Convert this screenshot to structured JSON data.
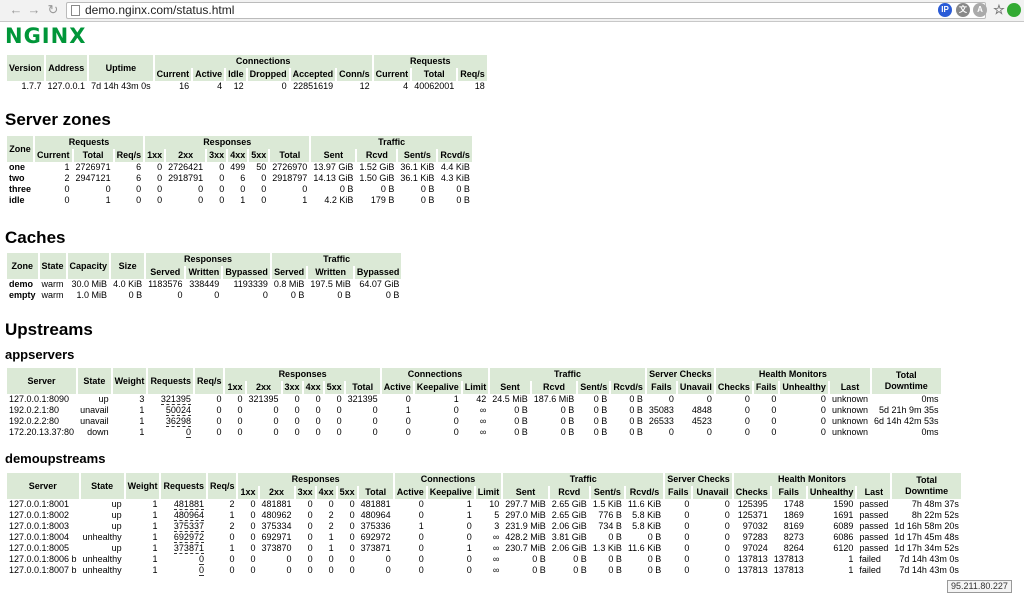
{
  "browser": {
    "url": "demo.nginx.com/status.html",
    "back_icon": "←",
    "forward_icon": "→"
  },
  "logo": {
    "text": "NGINX"
  },
  "colors": {
    "header_bg": "#dbe9d6",
    "logo": "#009639"
  },
  "summary": {
    "group_headers": {
      "connections": "Connections",
      "requests": "Requests"
    },
    "headers": [
      "Version",
      "Address",
      "Uptime",
      "Current",
      "Active",
      "Idle",
      "Dropped",
      "Accepted",
      "Conn/s",
      "Current",
      "Total",
      "Req/s"
    ],
    "row": [
      "1.7.7",
      "127.0.0.1",
      "7d 14h 43m 0s",
      "16",
      "4",
      "12",
      "0",
      "22851619",
      "12",
      "4",
      "40062001",
      "18"
    ]
  },
  "server_zones": {
    "title": "Server zones",
    "group_headers": {
      "zone": "Zone",
      "requests": "Requests",
      "responses": "Responses",
      "traffic": "Traffic"
    },
    "headers": [
      "Current",
      "Total",
      "Req/s",
      "1xx",
      "2xx",
      "3xx",
      "4xx",
      "5xx",
      "Total",
      "Sent",
      "Rcvd",
      "Sent/s",
      "Rcvd/s"
    ],
    "rows": [
      [
        "one",
        "1",
        "2726971",
        "6",
        "0",
        "2726421",
        "0",
        "499",
        "50",
        "2726970",
        "13.97 GiB",
        "1.52 GiB",
        "36.1 KiB",
        "4.4 KiB"
      ],
      [
        "two",
        "2",
        "2947121",
        "6",
        "0",
        "2918791",
        "0",
        "6",
        "0",
        "2918797",
        "14.13 GiB",
        "1.50 GiB",
        "36.1 KiB",
        "4.3 KiB"
      ],
      [
        "three",
        "0",
        "0",
        "0",
        "0",
        "0",
        "0",
        "0",
        "0",
        "0",
        "0 B",
        "0 B",
        "0 B",
        "0 B"
      ],
      [
        "idle",
        "0",
        "1",
        "0",
        "0",
        "0",
        "0",
        "1",
        "0",
        "1",
        "4.2 KiB",
        "179 B",
        "0 B",
        "0 B"
      ]
    ]
  },
  "caches": {
    "title": "Caches",
    "group_headers": {
      "responses": "Responses",
      "traffic": "Traffic"
    },
    "headers": [
      "Zone",
      "State",
      "Capacity",
      "Size",
      "Served",
      "Written",
      "Bypassed",
      "Served",
      "Written",
      "Bypassed"
    ],
    "rows": [
      [
        "demo",
        "warm",
        "30.0 MiB",
        "4.0 KiB",
        "1183576",
        "338449",
        "1193339",
        "0.8 MiB",
        "197.5 MiB",
        "64.07 GiB"
      ],
      [
        "empty",
        "warm",
        "1.0 MiB",
        "0 B",
        "0",
        "0",
        "0",
        "0 B",
        "0 B",
        "0 B"
      ]
    ]
  },
  "upstreams": {
    "title": "Upstreams",
    "group_headers": {
      "responses": "Responses",
      "connections": "Connections",
      "traffic": "Traffic",
      "server_checks": "Server Checks",
      "health_monitors": "Health Monitors",
      "total_downtime": "Total Downtime"
    },
    "headers": [
      "Server",
      "State",
      "Weight",
      "Requests",
      "Req/s",
      "1xx",
      "2xx",
      "3xx",
      "4xx",
      "5xx",
      "Total",
      "Active",
      "Keepalive",
      "Limit",
      "Sent",
      "Rcvd",
      "Sent/s",
      "Rcvd/s",
      "Fails",
      "Unavail",
      "Checks",
      "Fails",
      "Unhealthy",
      "Last"
    ],
    "appservers": {
      "title": "appservers",
      "rows": [
        [
          "127.0.0.1:8090",
          "up",
          "3",
          "321395",
          "0",
          "0",
          "321395",
          "0",
          "0",
          "0",
          "321395",
          "0",
          "1",
          "42",
          "24.5 MiB",
          "187.6 MiB",
          "0 B",
          "0 B",
          "0",
          "0",
          "0",
          "0",
          "0",
          "unknown",
          "0ms"
        ],
        [
          "192.0.2.1:80",
          "unavail",
          "1",
          "50024",
          "0",
          "0",
          "0",
          "0",
          "0",
          "0",
          "0",
          "1",
          "0",
          "∞",
          "0 B",
          "0 B",
          "0 B",
          "0 B",
          "35083",
          "4848",
          "0",
          "0",
          "0",
          "unknown",
          "5d 21h 9m 35s"
        ],
        [
          "192.0.2.2:80",
          "unavail",
          "1",
          "36298",
          "0",
          "0",
          "0",
          "0",
          "0",
          "0",
          "0",
          "0",
          "0",
          "∞",
          "0 B",
          "0 B",
          "0 B",
          "0 B",
          "26533",
          "4523",
          "0",
          "0",
          "0",
          "unknown",
          "6d 14h 42m 53s"
        ],
        [
          "172.20.13.37:80",
          "down",
          "1",
          "0",
          "0",
          "0",
          "0",
          "0",
          "0",
          "0",
          "0",
          "0",
          "0",
          "∞",
          "0 B",
          "0 B",
          "0 B",
          "0 B",
          "0",
          "0",
          "0",
          "0",
          "0",
          "unknown",
          "0ms"
        ]
      ]
    },
    "demoupstreams": {
      "title": "demoupstreams",
      "rows": [
        [
          "127.0.0.1:8001",
          "up",
          "1",
          "481881",
          "2",
          "0",
          "481881",
          "0",
          "0",
          "0",
          "481881",
          "0",
          "1",
          "10",
          "297.7 MiB",
          "2.65 GiB",
          "1.5 KiB",
          "11.6 KiB",
          "0",
          "0",
          "125395",
          "1748",
          "1590",
          "passed",
          "7h 48m 37s"
        ],
        [
          "127.0.0.1:8002",
          "up",
          "1",
          "480964",
          "1",
          "0",
          "480962",
          "0",
          "2",
          "0",
          "480964",
          "0",
          "1",
          "5",
          "297.0 MiB",
          "2.65 GiB",
          "776 B",
          "5.8 KiB",
          "0",
          "0",
          "125371",
          "1869",
          "1691",
          "passed",
          "8h 22m 52s"
        ],
        [
          "127.0.0.1:8003",
          "up",
          "1",
          "375337",
          "2",
          "0",
          "375334",
          "0",
          "2",
          "0",
          "375336",
          "1",
          "0",
          "3",
          "231.9 MiB",
          "2.06 GiB",
          "734 B",
          "5.8 KiB",
          "0",
          "0",
          "97032",
          "8169",
          "6089",
          "passed",
          "1d 16h 58m 20s"
        ],
        [
          "127.0.0.1:8004",
          "unhealthy",
          "1",
          "692972",
          "0",
          "0",
          "692971",
          "0",
          "1",
          "0",
          "692972",
          "0",
          "0",
          "∞",
          "428.2 MiB",
          "3.81 GiB",
          "0 B",
          "0 B",
          "0",
          "0",
          "97283",
          "8273",
          "6086",
          "passed",
          "1d 17h 45m 48s"
        ],
        [
          "127.0.0.1:8005",
          "up",
          "1",
          "373871",
          "1",
          "0",
          "373870",
          "0",
          "1",
          "0",
          "373871",
          "0",
          "1",
          "∞",
          "230.7 MiB",
          "2.06 GiB",
          "1.3 KiB",
          "11.6 KiB",
          "0",
          "0",
          "97024",
          "8264",
          "6120",
          "passed",
          "1d 17h 34m 52s"
        ],
        [
          "127.0.0.1:8006 b",
          "unhealthy",
          "1",
          "0",
          "0",
          "0",
          "0",
          "0",
          "0",
          "0",
          "0",
          "0",
          "0",
          "∞",
          "0 B",
          "0 B",
          "0 B",
          "0 B",
          "0",
          "0",
          "137813",
          "137813",
          "1",
          "failed",
          "7d 14h 43m 0s"
        ],
        [
          "127.0.0.1:8007 b",
          "unhealthy",
          "1",
          "0",
          "0",
          "0",
          "0",
          "0",
          "0",
          "0",
          "0",
          "0",
          "0",
          "∞",
          "0 B",
          "0 B",
          "0 B",
          "0 B",
          "0",
          "0",
          "137813",
          "137813",
          "1",
          "failed",
          "7d 14h 43m 0s"
        ]
      ]
    }
  },
  "status_tooltip": "95.211.80.227"
}
